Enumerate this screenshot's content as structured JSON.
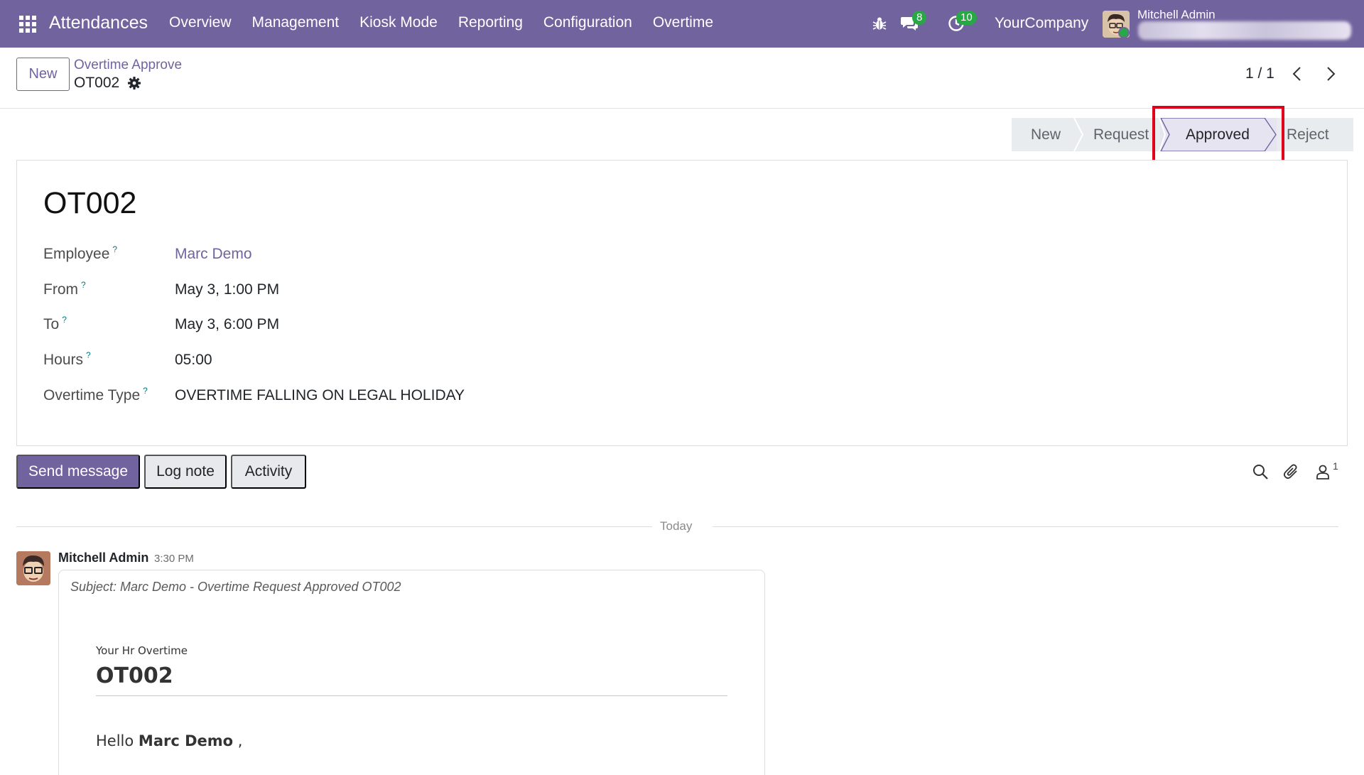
{
  "navbar": {
    "app_name": "Attendances",
    "menu": [
      "Overview",
      "Management",
      "Kiosk Mode",
      "Reporting",
      "Configuration",
      "Overtime"
    ],
    "messages_count": "8",
    "activities_count": "10",
    "company": "YourCompany",
    "user_name": "Mitchell Admin",
    "bg_color": "#71639e",
    "badge_color": "#28a745"
  },
  "control_panel": {
    "new_label": "New",
    "breadcrumb": "Overtime Approve",
    "record": "OT002",
    "pager": "1 / 1"
  },
  "statusbar": {
    "stages": [
      "New",
      "Request",
      "Approved",
      "Reject"
    ],
    "active": "Approved"
  },
  "form": {
    "title": "OT002",
    "fields": [
      {
        "label": "Employee",
        "help": "?",
        "value": "Marc Demo"
      },
      {
        "label": "From",
        "help": "?",
        "value": "May 3, 1:00 PM"
      },
      {
        "label": "To",
        "help": "?",
        "value": "May 3, 6:00 PM"
      },
      {
        "label": "Hours",
        "help": "?",
        "value": "05:00"
      },
      {
        "label": "Overtime Type",
        "help": "?",
        "value": "OVERTIME FALLING ON LEGAL HOLIDAY"
      }
    ]
  },
  "chatter": {
    "send_message": "Send message",
    "log_note": "Log note",
    "activity": "Activity",
    "followers_count": "1",
    "date_separator": "Today",
    "message": {
      "author": "Mitchell Admin",
      "time": "3:30 PM",
      "subject": "Subject: Marc Demo - Overtime Request Approved OT002",
      "mail_header": "Your Hr Overtime",
      "mail_title": "OT002",
      "greeting": "Hello",
      "greeting_name": "Marc Demo",
      "greeting_suffix": ","
    }
  }
}
